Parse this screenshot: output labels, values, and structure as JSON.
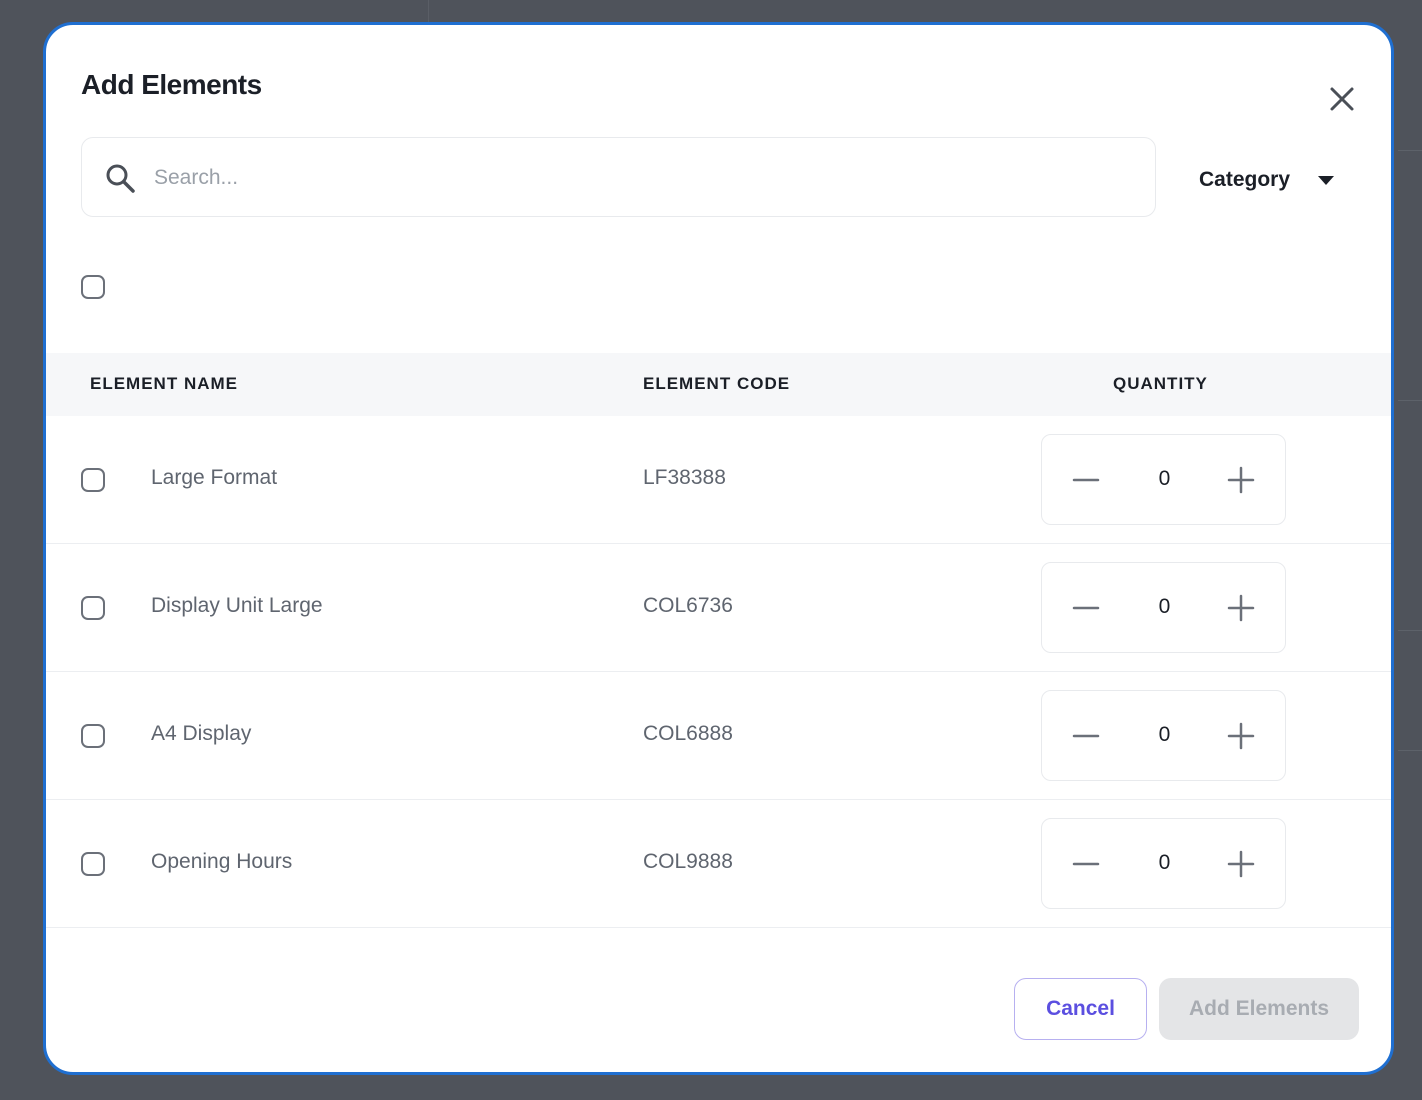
{
  "modal": {
    "title": "Add Elements",
    "close_icon": "close-icon"
  },
  "search": {
    "placeholder": "Search...",
    "value": "",
    "icon": "search-icon"
  },
  "category": {
    "label": "Category",
    "icon": "caret-down-icon"
  },
  "table": {
    "columns": [
      "ELEMENT NAME",
      "ELEMENT CODE",
      "QUANTITY"
    ],
    "rows": [
      {
        "name": "Large Format",
        "code": "LF38388",
        "quantity": "0",
        "checked": false
      },
      {
        "name": "Display Unit Large",
        "code": "COL6736",
        "quantity": "0",
        "checked": false
      },
      {
        "name": "A4 Display",
        "code": "COL6888",
        "quantity": "0",
        "checked": false
      },
      {
        "name": "Opening Hours",
        "code": "COL9888",
        "quantity": "0",
        "checked": false
      }
    ]
  },
  "footer": {
    "cancel_label": "Cancel",
    "add_label": "Add Elements"
  },
  "colors": {
    "modal_border": "#1f6fd1",
    "accent": "#5b4fe0",
    "overlay": "#4f535b"
  }
}
